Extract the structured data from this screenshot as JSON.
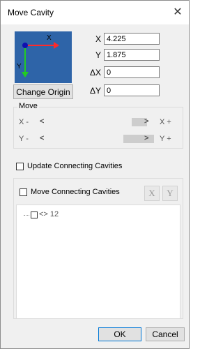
{
  "window": {
    "title": "Move Cavity",
    "close_glyph": "✕"
  },
  "origin_preview": {
    "x_axis_label": "X",
    "y_axis_label": "Y",
    "x_axis_color": "#ff2a2a",
    "y_axis_color": "#22cc22",
    "background_color": "#2e64a8"
  },
  "coords": {
    "x_label": "X",
    "x_value": "4.225",
    "y_label": "Y",
    "y_value": "1.875",
    "dx_label": "ΔX",
    "dx_value": "0",
    "dy_label": "ΔY",
    "dy_value": "0"
  },
  "change_origin_label": "Change Origin",
  "move_group": {
    "legend": "Move",
    "x_row": {
      "axis_label": "X -",
      "left_arrow": "<",
      "right_arrow": ">",
      "axis_plus_label": "X +"
    },
    "y_row": {
      "axis_label": "Y -",
      "left_arrow": "<",
      "right_arrow": ">",
      "axis_plus_label": "Y +"
    }
  },
  "update_connecting": {
    "label": "Update Connecting Cavities",
    "checked": false
  },
  "move_connecting": {
    "label": "Move Connecting Cavities",
    "checked": false,
    "x_button_label": "X",
    "y_button_label": "Y"
  },
  "tree": {
    "items": [
      {
        "label": "<> 12",
        "checked": false
      }
    ]
  },
  "buttons": {
    "ok_label": "OK",
    "cancel_label": "Cancel"
  }
}
